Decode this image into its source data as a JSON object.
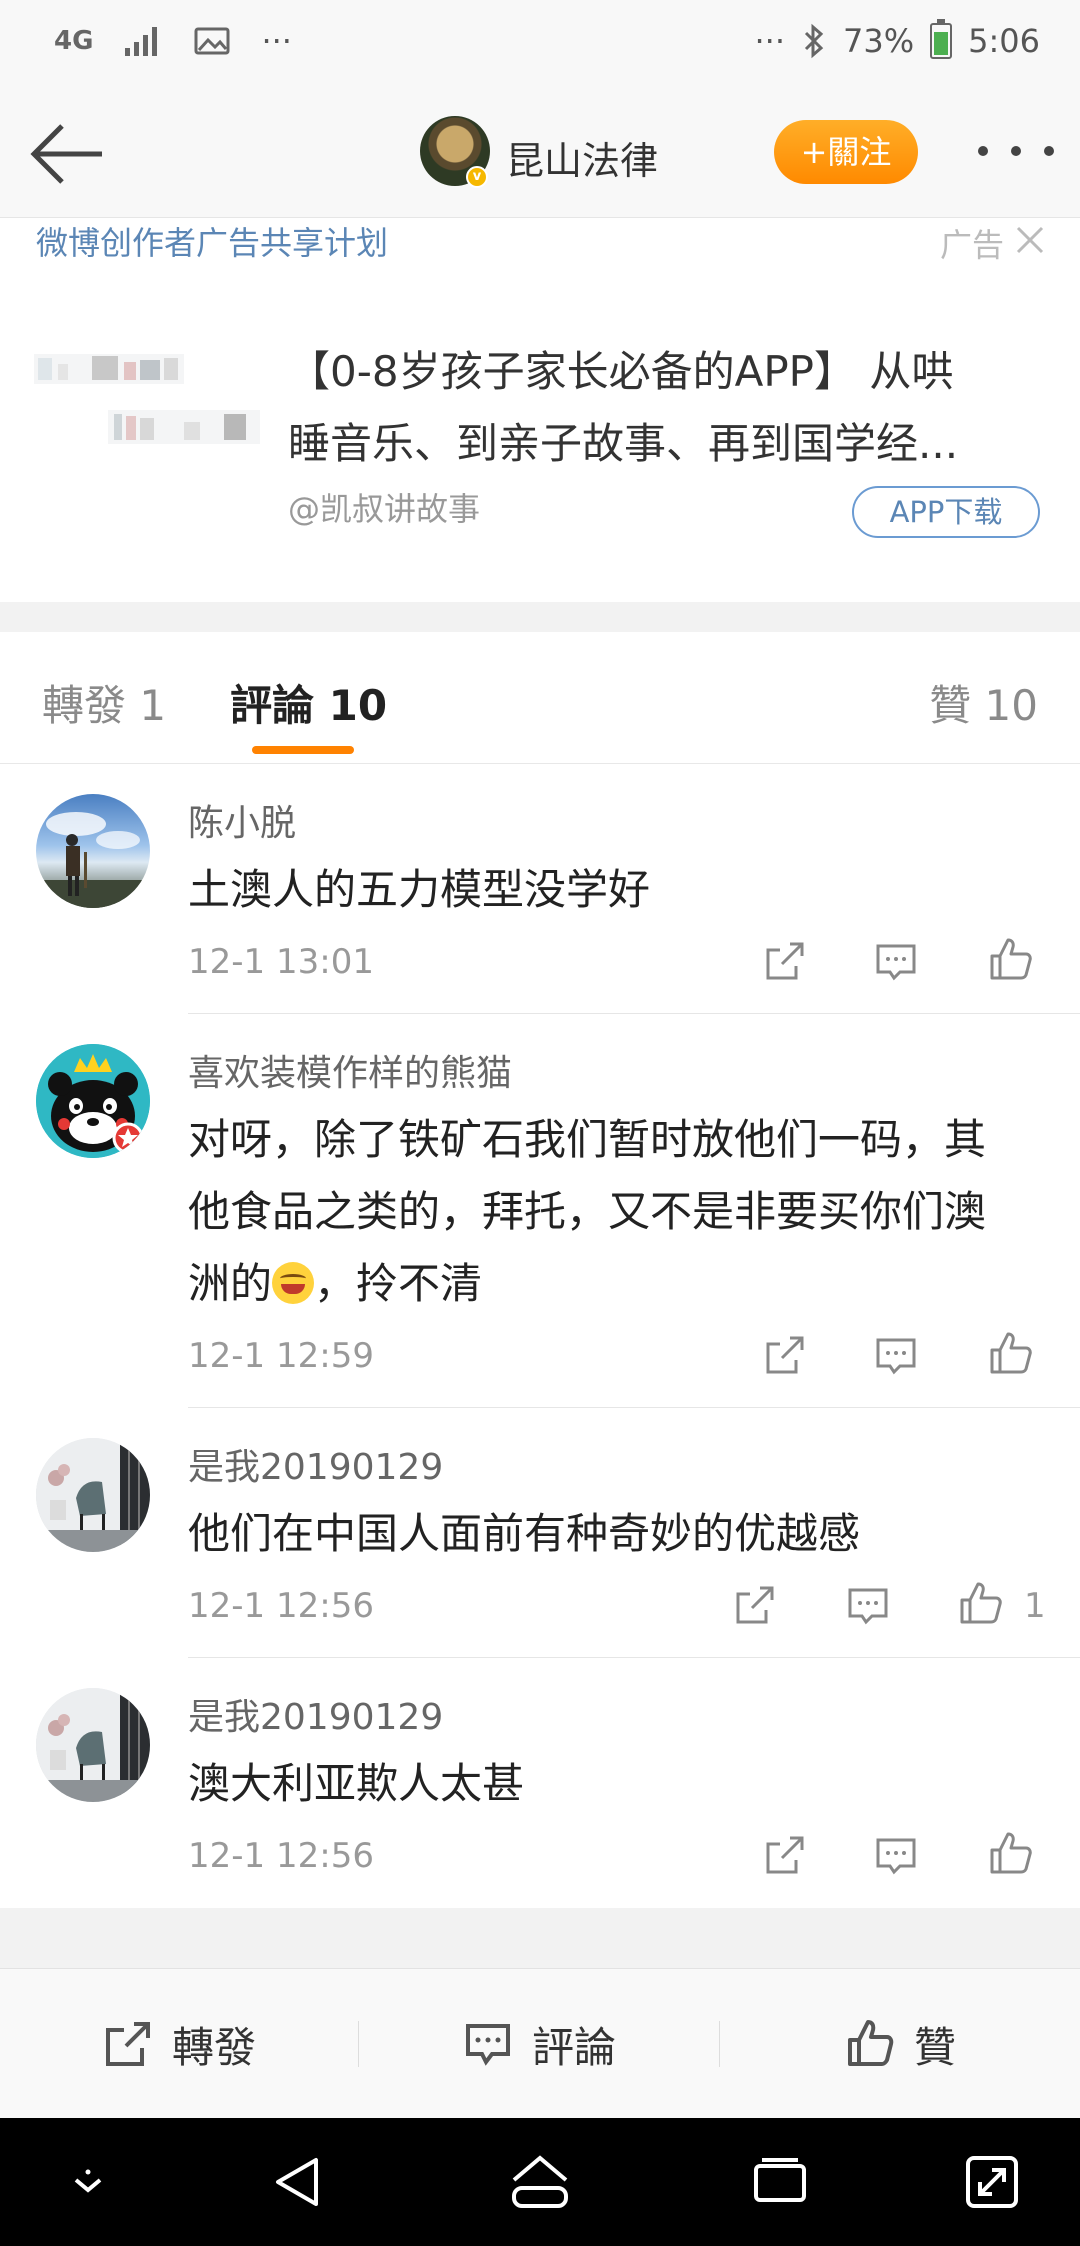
{
  "status_bar": {
    "network": "4G",
    "more_left": "···",
    "more_right": "···",
    "battery": "73%",
    "battery_level": 0.73,
    "time": "5:06"
  },
  "header": {
    "title": "昆山法律",
    "follow_label": "+關注",
    "icons": [
      "back-arrow-icon",
      "verified-badge-icon",
      "more-icon"
    ]
  },
  "ad": {
    "program": "微博创作者广告共享计划",
    "label": "广告",
    "line1": "【0-8岁孩子家长必备的APP】 从哄",
    "line2": "睡音乐、到亲子故事、再到国学经...",
    "source": "@凯叔讲故事",
    "button": "APP下载"
  },
  "tabs": {
    "repost": "轉發 1",
    "comment": "評論 10",
    "like": "贊 10"
  },
  "comments": [
    {
      "name": "陈小脱",
      "text": "土澳人的五力模型没学好",
      "time": "12-1 13:01",
      "likes": ""
    },
    {
      "name": "喜欢装模作样的熊猫",
      "line1": "对呀，除了铁矿石我们暂时放他们一码，其",
      "line2": "他食品之类的，拜托，又不是非要买你们澳",
      "line3_a": "洲的",
      "line3_b": "，拎不清",
      "time": "12-1 12:59",
      "likes": ""
    },
    {
      "name": "是我20190129",
      "text": "他们在中国人面前有种奇妙的优越感",
      "time": "12-1 12:56",
      "likes": "1"
    },
    {
      "name": "是我20190129",
      "text": "澳大利亚欺人太甚",
      "time": "12-1 12:56",
      "likes": ""
    }
  ],
  "toolbar": {
    "repost": "轉發",
    "comment": "評論",
    "like": "贊"
  },
  "colors": {
    "accent_orange": "#ff8200",
    "link_blue": "#5b86b5",
    "text_dark": "#222222",
    "text_gray": "#999999"
  }
}
